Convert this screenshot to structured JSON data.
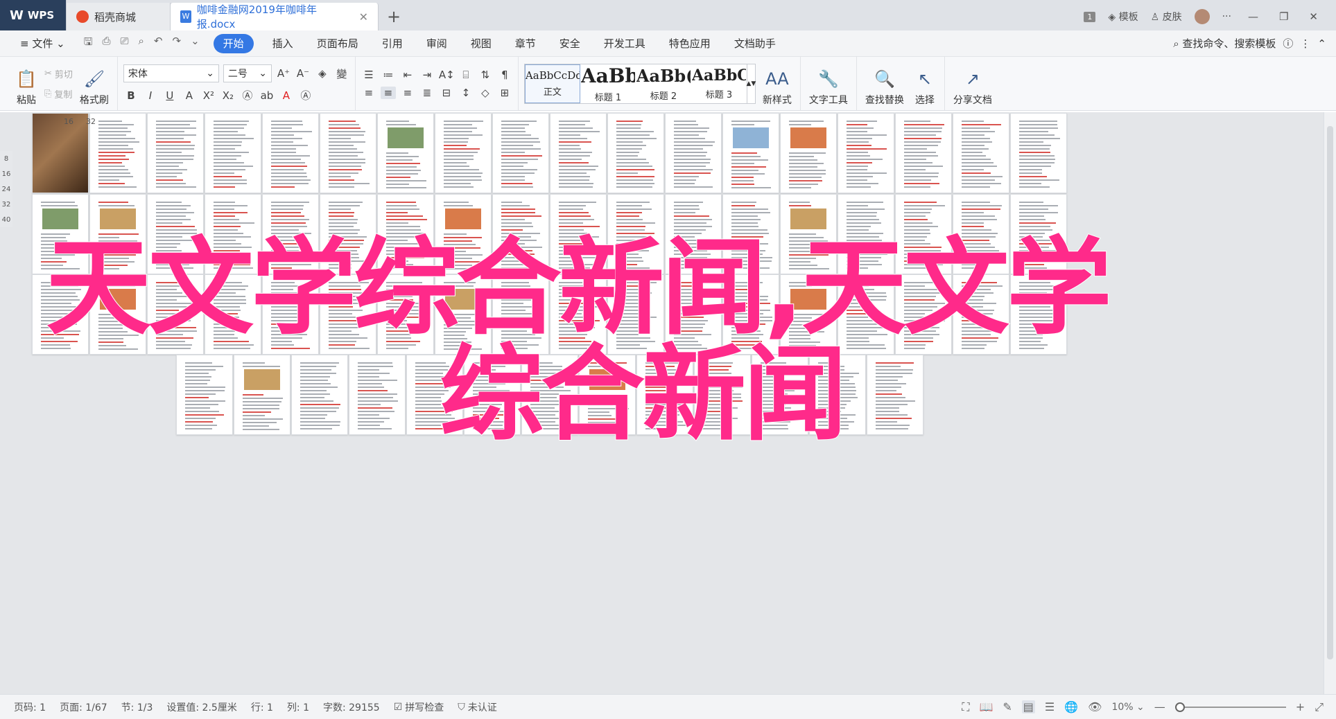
{
  "titlebar": {
    "wps_tab": "WPS",
    "store_tab": "稻壳商城",
    "doc_tab": "咖啡金融网2019年咖啡年报.docx",
    "badge": "1",
    "template_label": "模板",
    "skin_label": "皮肤"
  },
  "menubar": {
    "file": "文件",
    "items": [
      "开始",
      "插入",
      "页面布局",
      "引用",
      "审阅",
      "视图",
      "章节",
      "安全",
      "开发工具",
      "特色应用",
      "文档助手"
    ],
    "search": "查找命令、搜索模板"
  },
  "ribbon": {
    "paste": "粘贴",
    "cut": "剪切",
    "copy": "复制",
    "format_painter": "格式刷",
    "font_name": "宋体",
    "font_size": "二号",
    "styles": [
      {
        "preview": "AaBbCcDd",
        "label": "正文"
      },
      {
        "preview": "AaBb",
        "label": "标题 1"
      },
      {
        "preview": "AaBb(",
        "label": "标题 2"
      },
      {
        "preview": "AaBbC",
        "label": "标题 3"
      }
    ],
    "new_style": "新样式",
    "text_tools": "文字工具",
    "find_replace": "查找替换",
    "select": "选择",
    "share": "分享文档"
  },
  "ruler": {
    "h_marks": [
      "16",
      "32"
    ],
    "v_marks": [
      "8",
      "16",
      "24",
      "32",
      "40"
    ]
  },
  "overlay": {
    "line1": "天文学综合新闻,天文学",
    "line2": "综合新闻",
    "color": "#ff2a8a"
  },
  "statusbar": {
    "page_num": "页码: 1",
    "page": "页面: 1/67",
    "section": "节: 1/3",
    "setting": "设置值: 2.5厘米",
    "row": "行: 1",
    "col": "列: 1",
    "words": "字数: 29155",
    "spellcheck": "拼写检查",
    "cert": "未认证",
    "zoom": "10%"
  }
}
